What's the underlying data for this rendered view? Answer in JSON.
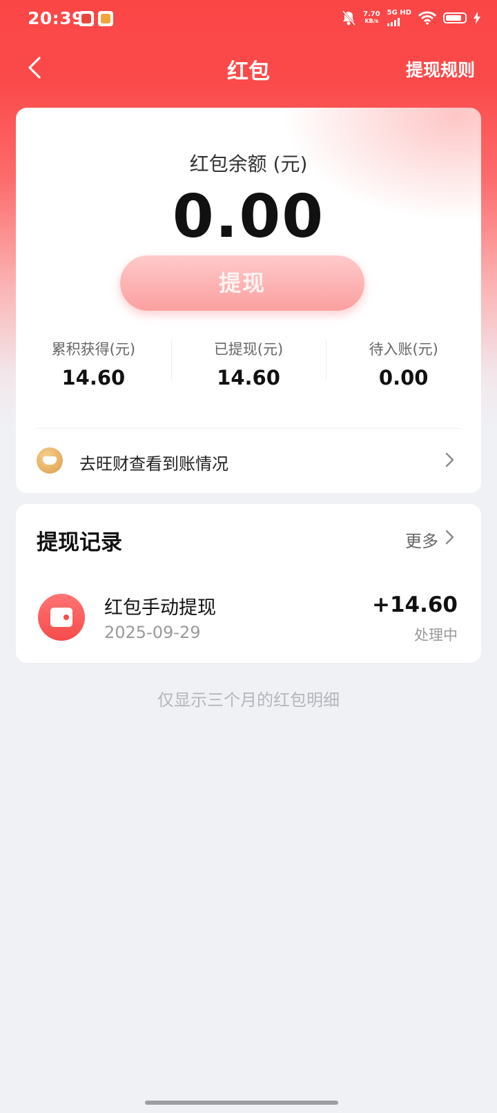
{
  "status_bar": {
    "time": "20:39",
    "speed_value": "7.70",
    "speed_unit": "KB/s",
    "network": "5G HD",
    "icons": [
      "mute-bell-icon",
      "wifi-icon",
      "battery-icon",
      "charging-icon"
    ]
  },
  "nav": {
    "title": "红包",
    "rules_link": "提现规则",
    "back_icon": "chevron-left-icon"
  },
  "balance": {
    "label": "红包余额 (元)",
    "amount": "0.00",
    "withdraw_button": "提现"
  },
  "stats": [
    {
      "label": "累积获得(元)",
      "value": "14.60"
    },
    {
      "label": "已提现(元)",
      "value": "14.60"
    },
    {
      "label": "待入账(元)",
      "value": "0.00"
    }
  ],
  "wangcai_link": {
    "text": "去旺财查看到账情况",
    "icon": "gold-ingot-icon"
  },
  "records": {
    "title": "提现记录",
    "more": "更多",
    "items": [
      {
        "name": "红包手动提现",
        "date": "2025-09-29",
        "amount": "+14.60",
        "status": "处理中",
        "icon": "wallet-icon"
      }
    ]
  },
  "footnote": "仅显示三个月的红包明细",
  "colors": {
    "brand_red": "#fb4646",
    "button_pink": "#fc9f9f",
    "page_bg": "#f0f1f5"
  }
}
